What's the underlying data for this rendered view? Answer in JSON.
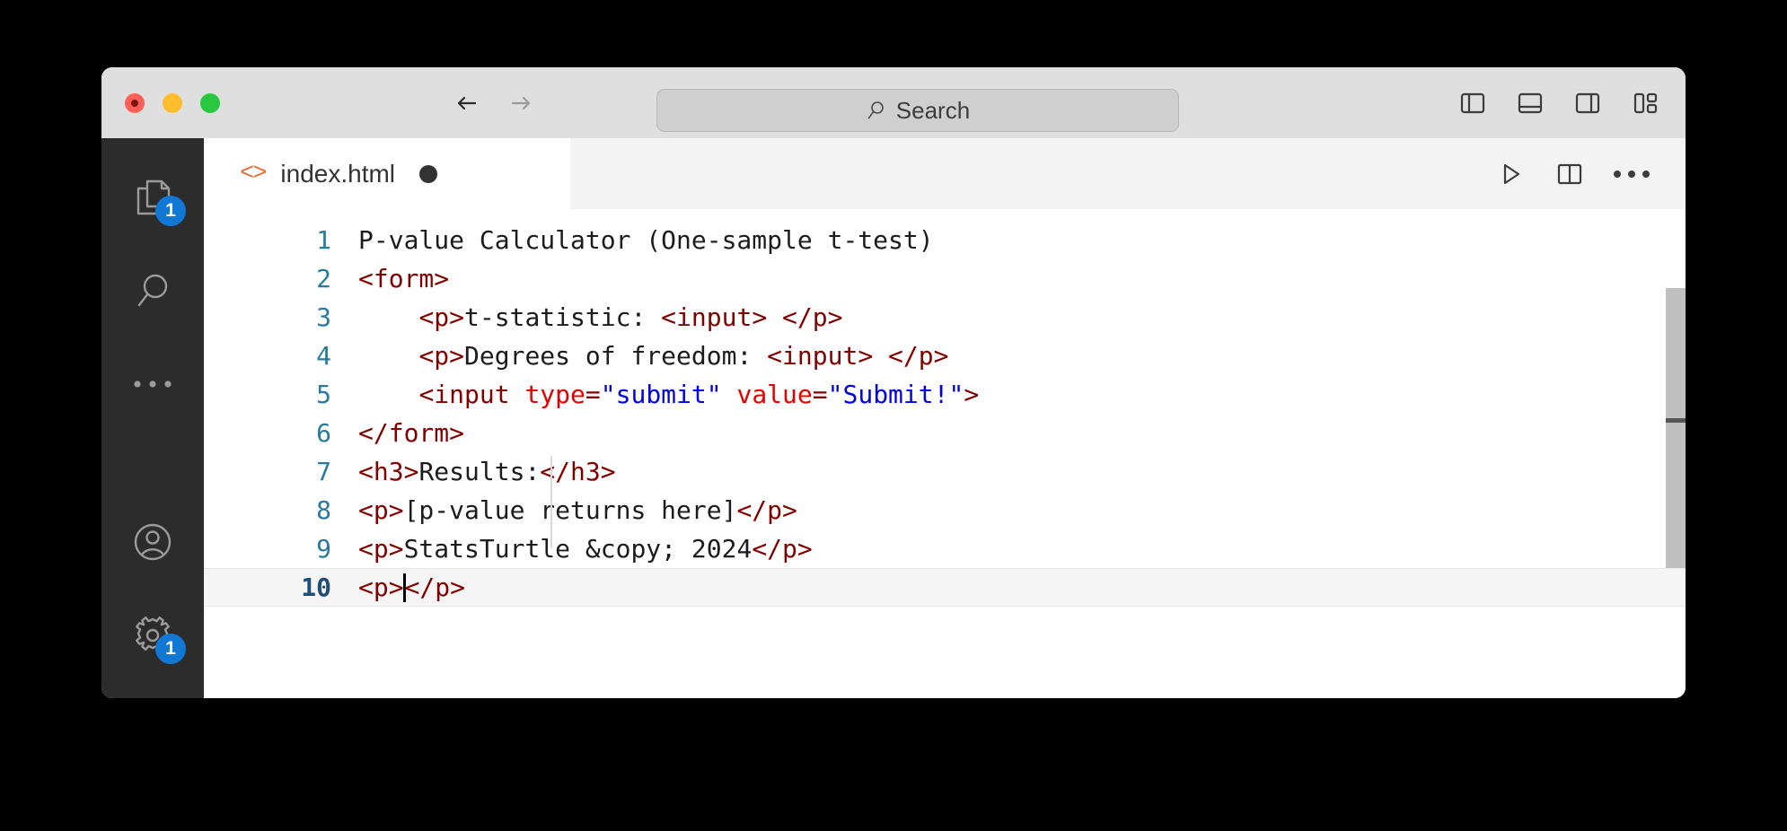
{
  "window": {
    "traffic_lights": [
      "close",
      "minimize",
      "zoom"
    ]
  },
  "titlebar": {
    "back_label": "Back",
    "forward_label": "Forward",
    "search": {
      "placeholder": "Search",
      "icon": "search-icon"
    },
    "layout_buttons": [
      {
        "name": "toggle-primary-sidebar",
        "icon": "panel-left-icon"
      },
      {
        "name": "toggle-panel",
        "icon": "panel-bottom-icon"
      },
      {
        "name": "toggle-secondary-sidebar",
        "icon": "panel-right-icon"
      },
      {
        "name": "customize-layout",
        "icon": "layout-grid-icon"
      }
    ]
  },
  "activitybar": {
    "items": [
      {
        "name": "explorer",
        "icon": "files-icon",
        "badge": "1"
      },
      {
        "name": "search",
        "icon": "search-icon",
        "badge": ""
      },
      {
        "name": "more-views",
        "icon": "ellipsis-icon",
        "badge": ""
      },
      {
        "name": "accounts",
        "icon": "account-icon",
        "badge": ""
      },
      {
        "name": "manage-settings",
        "icon": "gear-icon",
        "badge": "1"
      }
    ]
  },
  "tabbar": {
    "tab": {
      "icon": "html-code-icon",
      "filename": "index.html",
      "dirty": true
    },
    "actions": [
      {
        "name": "run-file",
        "icon": "play-icon"
      },
      {
        "name": "split-editor-right",
        "icon": "split-editor-icon"
      },
      {
        "name": "more-actions",
        "icon": "ellipsis-icon"
      }
    ]
  },
  "editor": {
    "active_line": 10,
    "colors": {
      "tag": "#800000",
      "attribute": "#e50000",
      "value": "#0000e0",
      "text": "#1c1c1c",
      "line_number": "#2a7a9b",
      "annotation": "#ff0000"
    },
    "lines": [
      {
        "n": "1",
        "text": "P-value Calculator (One-sample t-test)"
      },
      {
        "n": "2",
        "text": "<form>"
      },
      {
        "n": "3",
        "text": "    <p>t-statistic: <input> </p>"
      },
      {
        "n": "4",
        "text": "    <p>Degrees of freedom: <input> </p>"
      },
      {
        "n": "5",
        "text": "    <input type=\"submit\" value=\"Submit!\">"
      },
      {
        "n": "6",
        "text": "</form>"
      },
      {
        "n": "7",
        "text": "<h3>Results:</h3>"
      },
      {
        "n": "8",
        "text": "<p>[p-value returns here]</p>"
      },
      {
        "n": "9",
        "text": "<p>StatsTurtle &copy; 2024</p>"
      },
      {
        "n": "10",
        "text": "<p></p>"
      }
    ],
    "line_numbers": [
      "1",
      "2",
      "3",
      "4",
      "5",
      "6",
      "7",
      "8",
      "9",
      "10"
    ]
  }
}
